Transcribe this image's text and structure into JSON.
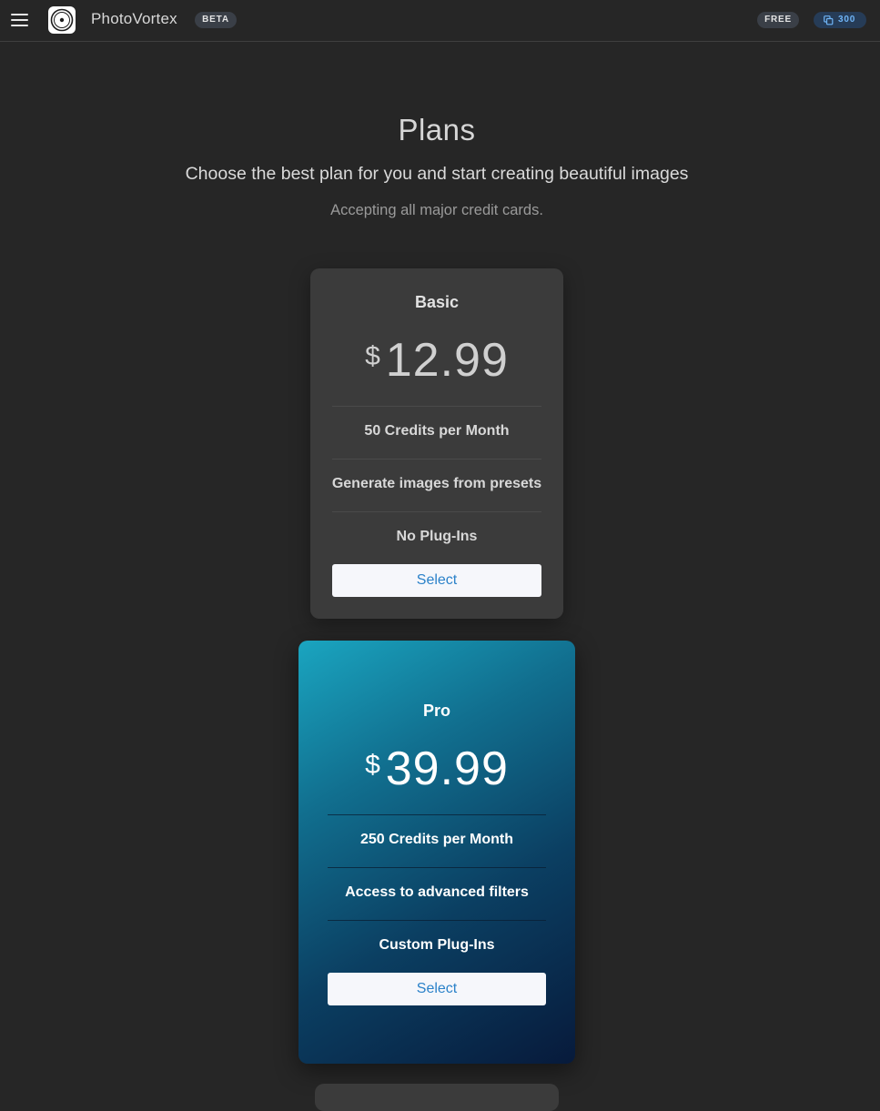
{
  "header": {
    "app_name": "PhotoVortex",
    "beta_badge": "BETA",
    "plan_badge": "FREE",
    "credits": "300"
  },
  "page": {
    "title": "Plans",
    "subtitle": "Choose the best plan for you and start creating beautiful images",
    "note": "Accepting all major credit cards."
  },
  "plans": [
    {
      "name": "Basic",
      "currency": "$",
      "price": "12.99",
      "features": [
        "50 Credits per Month",
        "Generate images from presets",
        "No Plug-Ins"
      ],
      "button": "Select"
    },
    {
      "name": "Pro",
      "currency": "$",
      "price": "39.99",
      "features": [
        "250 Credits per Month",
        "Access to advanced filters",
        "Custom Plug-Ins"
      ],
      "button": "Select"
    }
  ],
  "colors": {
    "background": "#262626",
    "card_basic": "#3b3b3b",
    "pro_gradient_start": "#1aa5c0",
    "pro_gradient_end": "#071a3b",
    "button_text": "#2b82c9",
    "credits_badge_text": "#6fb4f5"
  },
  "icons": {
    "menu": "hamburger-menu-icon",
    "logo": "vortex-logo-icon",
    "credits": "copy-credits-icon"
  }
}
